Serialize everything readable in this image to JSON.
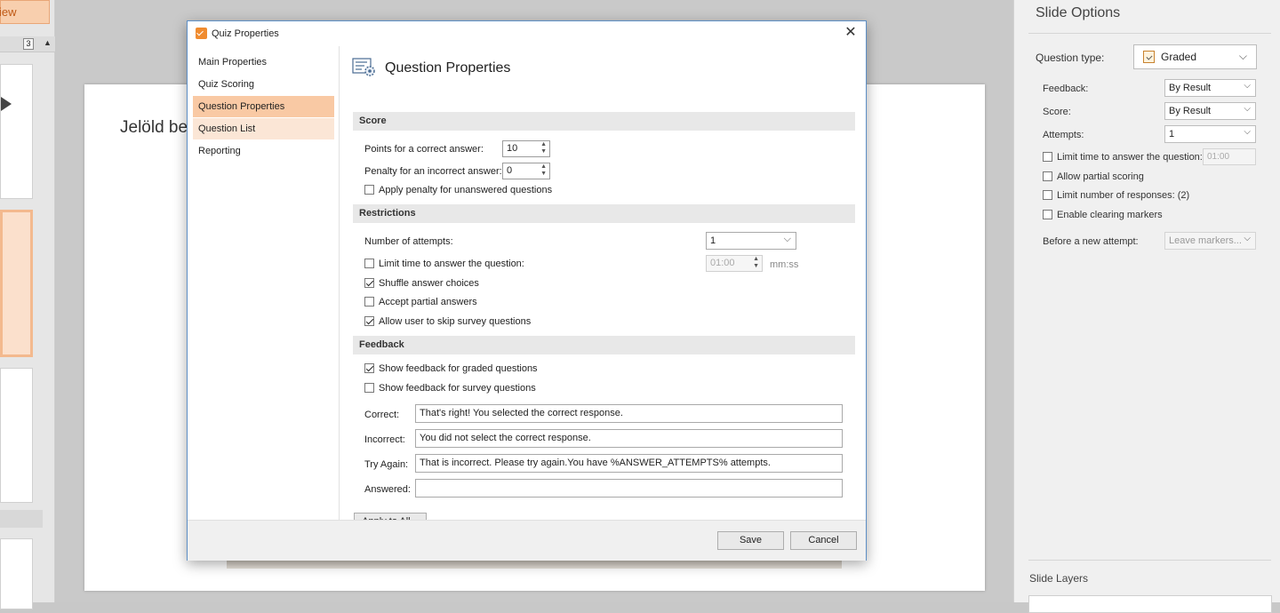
{
  "background": {
    "view_button": "iew",
    "thumb_count": "3",
    "slide_title": "Jelöld be"
  },
  "slide_options": {
    "title": "Slide Options",
    "question_type_label": "Question type:",
    "question_type_value": "Graded",
    "feedback_label": "Feedback:",
    "feedback_value": "By Result",
    "score_label": "Score:",
    "score_value": "By Result",
    "attempts_label": "Attempts:",
    "attempts_value": "1",
    "limit_time_label": "Limit time to answer the question:",
    "limit_time_value": "01:00",
    "allow_partial_label": "Allow partial scoring",
    "limit_responses_label": "Limit number of responses: (2)",
    "enable_clearing_label": "Enable clearing markers",
    "before_attempt_label": "Before a new attempt:",
    "before_attempt_value": "Leave markers...",
    "slide_layers_label": "Slide Layers"
  },
  "dialog": {
    "title": "Quiz Properties",
    "nav": [
      {
        "label": "Main Properties"
      },
      {
        "label": "Quiz Scoring"
      },
      {
        "label": "Question Properties"
      },
      {
        "label": "Question List"
      },
      {
        "label": "Reporting"
      }
    ],
    "heading": "Question Properties",
    "score": {
      "section": "Score",
      "points_label": "Points for a correct answer:",
      "points_value": "10",
      "penalty_label": "Penalty for an incorrect answer:",
      "penalty_value": "0",
      "apply_penalty_label": "Apply penalty for unanswered questions"
    },
    "restrictions": {
      "section": "Restrictions",
      "attempts_label": "Number of attempts:",
      "attempts_value": "1",
      "limit_time_label": "Limit time to answer the question:",
      "limit_time_value": "01:00",
      "limit_time_unit": "mm:ss",
      "shuffle_label": "Shuffle answer choices",
      "partial_label": "Accept partial answers",
      "skip_label": "Allow user to skip survey questions"
    },
    "feedback": {
      "section": "Feedback",
      "graded_label": "Show feedback for graded questions",
      "survey_label": "Show feedback for survey questions",
      "correct_label": "Correct:",
      "correct_value": "That's right! You selected the correct response.",
      "incorrect_label": "Incorrect:",
      "incorrect_value": "You did not select the correct response.",
      "try_again_label": "Try Again:",
      "try_again_value": "That is incorrect. Please try again.You have %ANSWER_ATTEMPTS% attempts.",
      "answered_label": "Answered:",
      "answered_value": ""
    },
    "apply_all_button": "Apply to All...",
    "save_button": "Save",
    "cancel_button": "Cancel"
  }
}
